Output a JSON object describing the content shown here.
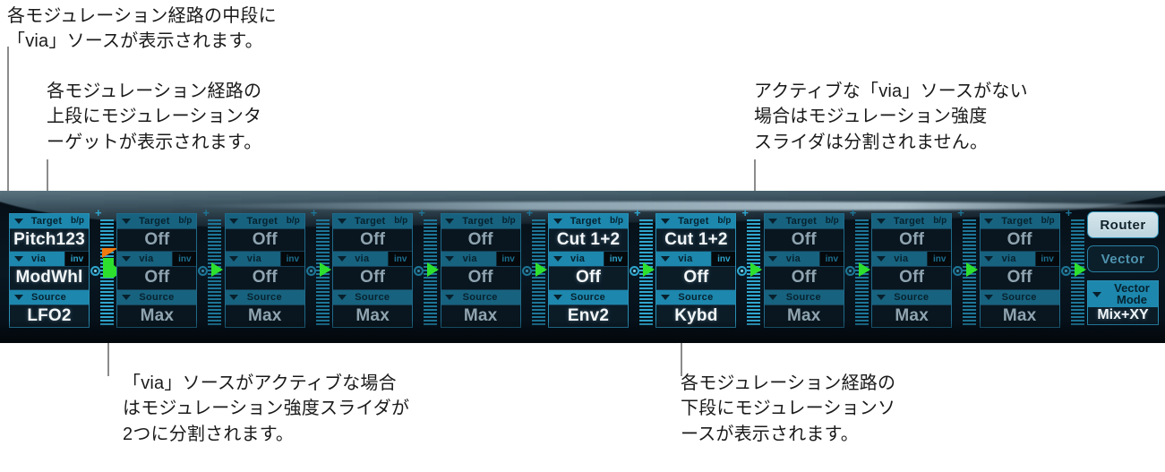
{
  "annotations": {
    "top_left": "各モジュレーション経路の中段に\n「via」ソースが表示されます。",
    "target_row": "各モジュレーション経路の\n上段にモジュレーションタ\nーゲットが表示されます。",
    "top_right": "アクティブな「via」ソースがない\n場合はモジュレーション強度\nスライダは分割されません。",
    "bottom_left": "「via」ソースがアクティブな場合\nはモジュレーション強度スライダが\n2つに分割されます。",
    "bottom_right": "各モジュレーション経路の\n下段にモジュレーションソ\nースが表示されます。"
  },
  "router": {
    "row_labels": {
      "target": "Target",
      "bp": "b/p",
      "via": "via",
      "inv": "inv",
      "source": "Source"
    },
    "slots": [
      {
        "index": 1,
        "target": "Pitch123",
        "via": "ModWhl",
        "source": "LFO2",
        "active": true,
        "slider": "split"
      },
      {
        "index": 2,
        "target": "Off",
        "via": "Off",
        "source": "Max",
        "active": false,
        "slider": "single"
      },
      {
        "index": 3,
        "target": "Off",
        "via": "Off",
        "source": "Max",
        "active": false,
        "slider": "single"
      },
      {
        "index": 4,
        "target": "Off",
        "via": "Off",
        "source": "Max",
        "active": false,
        "slider": "single"
      },
      {
        "index": 5,
        "target": "Off",
        "via": "Off",
        "source": "Max",
        "active": false,
        "slider": "single"
      },
      {
        "index": 6,
        "target": "Cut 1+2",
        "via": "Off",
        "source": "Env2",
        "active": true,
        "slider": "single"
      },
      {
        "index": 7,
        "target": "Cut 1+2",
        "via": "Off",
        "source": "Kybd",
        "active": true,
        "slider": "single"
      },
      {
        "index": 8,
        "target": "Off",
        "via": "Off",
        "source": "Max",
        "active": false,
        "slider": "single"
      },
      {
        "index": 9,
        "target": "Off",
        "via": "Off",
        "source": "Max",
        "active": false,
        "slider": "single"
      },
      {
        "index": 10,
        "target": "Off",
        "via": "Off",
        "source": "Max",
        "active": false,
        "slider": "single"
      }
    ],
    "plus_label": "+"
  },
  "side_controls": {
    "router_button": "Router",
    "vector_button": "Vector",
    "vector_mode_label_line1": "Vector",
    "vector_mode_label_line2": "Mode",
    "vector_mode_value": "Mix+XY"
  },
  "colors": {
    "panel_bg": "#081722",
    "accent_teal": "#1d87ad",
    "accent_bright": "#2fa6cd",
    "slider_green": "#2ee02e",
    "slider_orange": "#f07a10",
    "text_white": "#f2f6f8",
    "text_dim": "#8fa4b0",
    "leader_gray": "#8c8c8c"
  }
}
